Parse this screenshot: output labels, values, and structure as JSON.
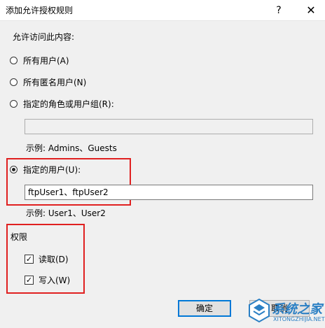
{
  "window": {
    "title": "添加允许授权规则",
    "help_glyph": "?",
    "close_glyph": "✕"
  },
  "access": {
    "heading": "允许访问此内容:",
    "options": [
      {
        "label": "所有用户(A)",
        "checked": false
      },
      {
        "label": "所有匿名用户(N)",
        "checked": false
      },
      {
        "label": "指定的角色或用户组(R):",
        "checked": false
      },
      {
        "label": "指定的用户(U):",
        "checked": true
      }
    ],
    "roles_value": "",
    "roles_example": "示例: Admins、Guests",
    "users_value": "ftpUser1、ftpUser2",
    "users_example": "示例: User1、User2"
  },
  "permissions": {
    "heading": "权限",
    "read": {
      "label": "读取(D)",
      "checked": true
    },
    "write": {
      "label": "写入(W)",
      "checked": true
    }
  },
  "buttons": {
    "ok": "确定",
    "cancel": "取消"
  },
  "watermark": {
    "text": "系统之家",
    "sub": "XITONGZHIJIA.NET"
  },
  "colors": {
    "highlight": "#e02020",
    "default_button_border": "#0078d7"
  }
}
